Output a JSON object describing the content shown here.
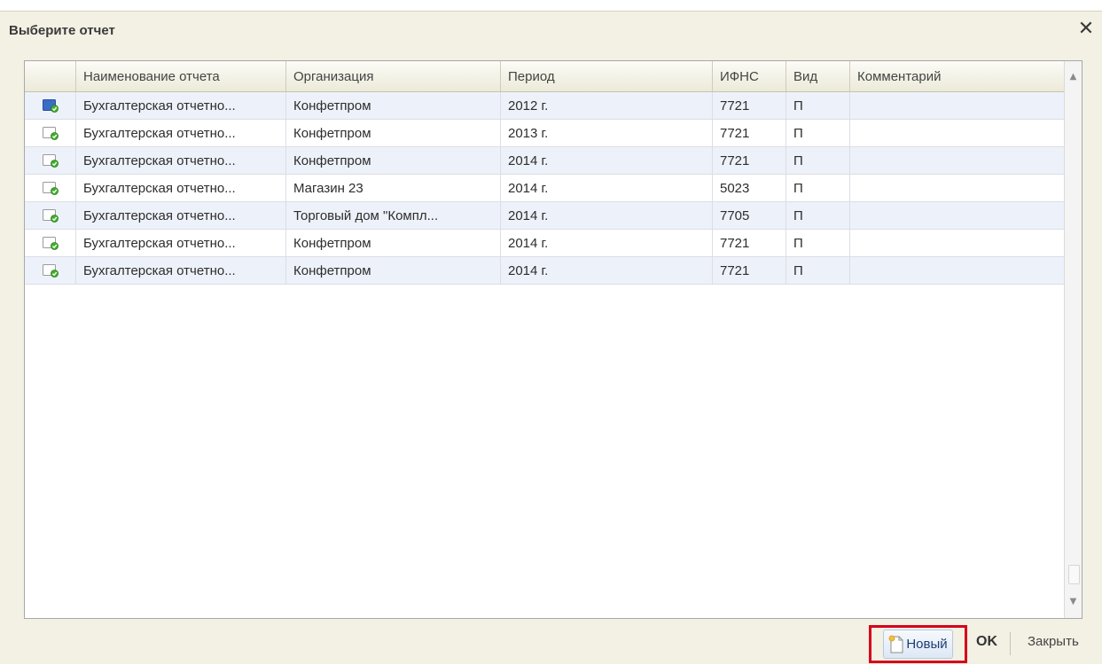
{
  "window": {
    "title": "Выберите отчет",
    "close_glyph": "✕"
  },
  "table": {
    "columns": [
      "",
      "Наименование отчета",
      "Организация",
      "Период",
      "ИФНС",
      "Вид",
      "Комментарий"
    ],
    "rows": [
      {
        "icon": "report-document-icon",
        "selected": true,
        "name": "Бухгалтерская отчетно...",
        "org": "Конфетпром",
        "period": "2012 г.",
        "ifns": "7721",
        "kind": "П",
        "comment": ""
      },
      {
        "icon": "report-document-icon",
        "selected": false,
        "name": "Бухгалтерская отчетно...",
        "org": "Конфетпром",
        "period": "2013 г.",
        "ifns": "7721",
        "kind": "П",
        "comment": ""
      },
      {
        "icon": "report-document-icon",
        "selected": false,
        "name": "Бухгалтерская отчетно...",
        "org": "Конфетпром",
        "period": "2014 г.",
        "ifns": "7721",
        "kind": "П",
        "comment": ""
      },
      {
        "icon": "report-document-icon",
        "selected": false,
        "name": "Бухгалтерская отчетно...",
        "org": "Магазин 23",
        "period": "2014 г.",
        "ifns": "5023",
        "kind": "П",
        "comment": ""
      },
      {
        "icon": "report-document-icon",
        "selected": false,
        "name": "Бухгалтерская отчетно...",
        "org": "Торговый дом \"Компл...",
        "period": "2014 г.",
        "ifns": "7705",
        "kind": "П",
        "comment": ""
      },
      {
        "icon": "report-document-icon",
        "selected": false,
        "name": "Бухгалтерская отчетно...",
        "org": "Конфетпром",
        "period": "2014 г.",
        "ifns": "7721",
        "kind": "П",
        "comment": ""
      },
      {
        "icon": "report-document-icon",
        "selected": false,
        "name": "Бухгалтерская отчетно...",
        "org": "Конфетпром",
        "period": "2014 г.",
        "ifns": "7721",
        "kind": "П",
        "comment": ""
      }
    ],
    "scroll_up_glyph": "▲",
    "scroll_down_glyph": "▼"
  },
  "footer": {
    "new_label": "Новый",
    "ok_label": "OK",
    "close_label": "Закрыть"
  },
  "colors": {
    "window_bg": "#f3f0e4",
    "row_alt": "#edf2fa",
    "highlight_frame": "#d6001c"
  }
}
